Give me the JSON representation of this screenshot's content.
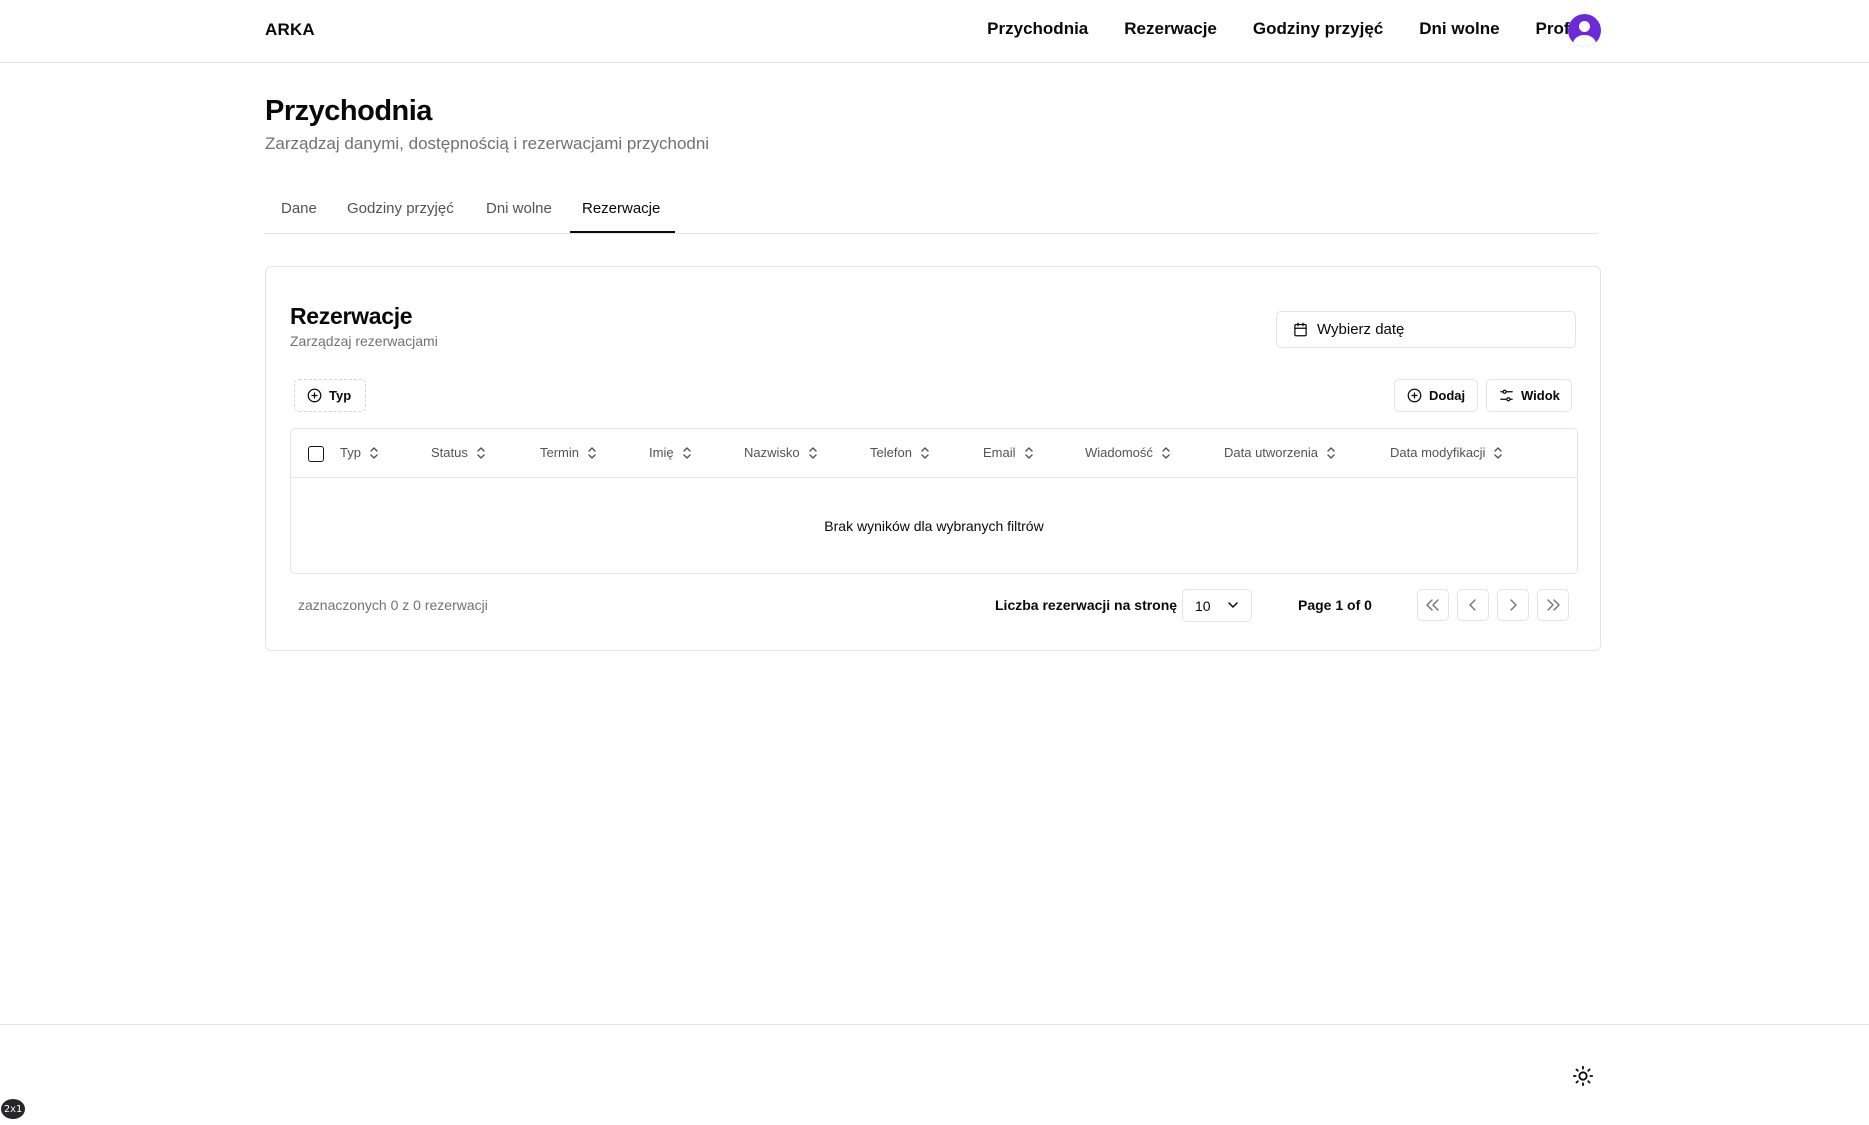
{
  "header": {
    "brand": "ARKA",
    "nav": [
      "Przychodnia",
      "Rezerwacje",
      "Godziny przyjęć",
      "Dni wolne",
      "Profil"
    ]
  },
  "page": {
    "title": "Przychodnia",
    "subtitle": "Zarządzaj danymi, dostępnością i rezerwacjami przychodni"
  },
  "tabs": [
    "Dane",
    "Godziny przyjęć",
    "Dni wolne",
    "Rezerwacje"
  ],
  "active_tab": "Rezerwacje",
  "card": {
    "title": "Rezerwacje",
    "subtitle": "Zarządzaj rezerwacjami",
    "date_button": "Wybierz datę",
    "filter_button": "Typ",
    "add_button": "Dodaj",
    "view_button": "Widok"
  },
  "table": {
    "columns": [
      "Typ",
      "Status",
      "Termin",
      "Imię",
      "Nazwisko",
      "Telefon",
      "Email",
      "Wiadomość",
      "Data utworzenia",
      "Data modyfikacji"
    ],
    "empty_message": "Brak wyników dla wybranych filtrów"
  },
  "footer": {
    "selected_text": "zaznaczonych 0 z 0 rezerwacji",
    "per_page_label": "Liczba rezerwacji na stronę",
    "per_page_value": "10",
    "page_info": "Page 1 of 0"
  },
  "badge": "2x1",
  "colors": {
    "accent": "#6d28d9",
    "border": "#e4e4e7",
    "muted_text": "#71717a"
  }
}
